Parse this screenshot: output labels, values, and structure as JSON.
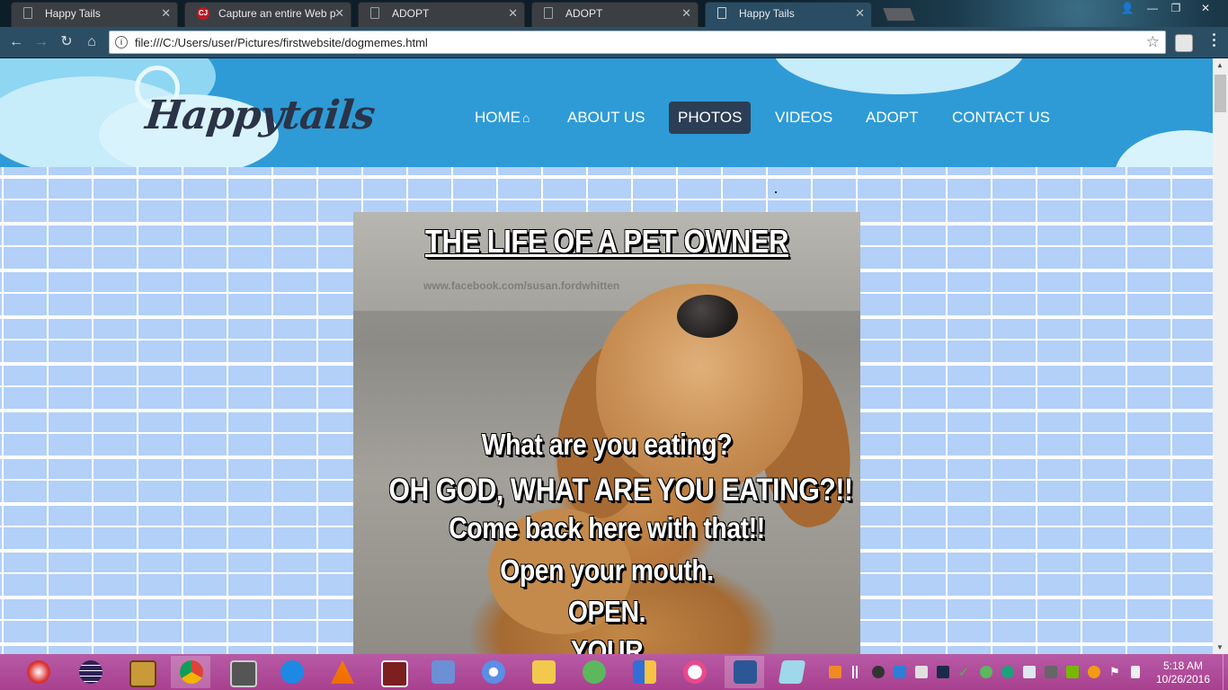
{
  "browser": {
    "tabs": [
      {
        "title": "Happy Tails",
        "favicon": "page-icon",
        "active": false
      },
      {
        "title": "Capture an entire Web p",
        "favicon": "cj-icon",
        "active": false
      },
      {
        "title": "ADOPT",
        "favicon": "page-icon",
        "active": false
      },
      {
        "title": "ADOPT",
        "favicon": "page-icon",
        "active": false
      },
      {
        "title": "Happy Tails",
        "favicon": "page-icon",
        "active": true
      }
    ],
    "close_glyph": "✕",
    "url": "file:///C:/Users/user/Pictures/firstwebsite/dogmemes.html",
    "window_controls": {
      "user": "👤",
      "minimize": "—",
      "maximize": "❐",
      "close": "✕"
    }
  },
  "site": {
    "logo": "Happytails",
    "nav": [
      {
        "label": "HOME",
        "icon": "house-icon",
        "active": false
      },
      {
        "label": "ABOUT US",
        "active": false
      },
      {
        "label": "PHOTOS",
        "active": true
      },
      {
        "label": "VIDEOS",
        "active": false
      },
      {
        "label": "ADOPT",
        "active": false
      },
      {
        "label": "CONTACT US",
        "active": false
      }
    ],
    "meme": {
      "title": "THE LIFE OF A PET OWNER",
      "watermark": "www.facebook.com/susan.fordwhitten",
      "lines": [
        "What are you eating?",
        "OH GOD, WHAT ARE YOU EATING?!!",
        "Come back here with that!!",
        "Open your mouth.",
        "OPEN.",
        "YOUR"
      ]
    }
  },
  "taskbar": {
    "clock_time": "5:18 AM",
    "clock_date": "10/26/2016"
  },
  "colors": {
    "header_blue": "#2e9bd6",
    "brick_blue": "#b2d0f8",
    "nav_active": "#2c3e55",
    "taskbar": "#b0469c"
  }
}
